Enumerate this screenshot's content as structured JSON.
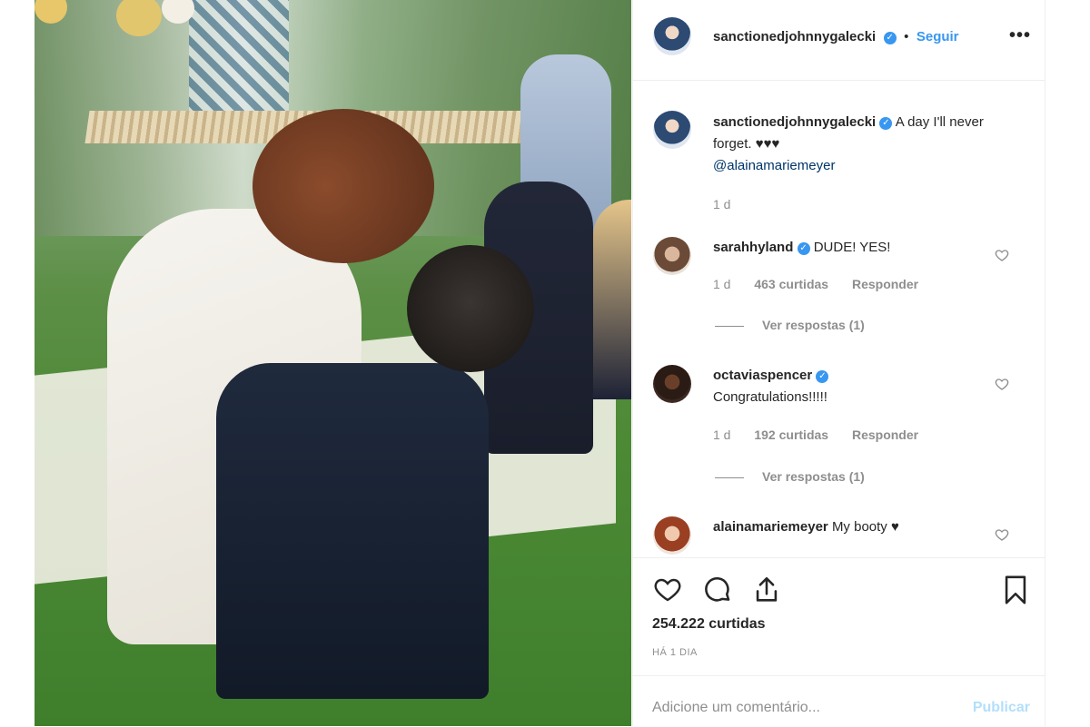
{
  "header": {
    "username": "sanctionedjohnnygalecki",
    "separator": "•",
    "follow_label": "Seguir",
    "more": "•••"
  },
  "caption": {
    "username": "sanctionedjohnnygalecki",
    "text": "A day I'll never forget. ♥♥♥",
    "mention": "@alainamariemeyer",
    "time": "1 d"
  },
  "comments": [
    {
      "username": "sarahhyland",
      "verified": true,
      "text": "DUDE! YES!",
      "time": "1 d",
      "likes": "463 curtidas",
      "reply": "Responder",
      "view_replies": "Ver respostas (1)"
    },
    {
      "username": "octaviaspencer",
      "verified": true,
      "text": "Congratulations!!!!!",
      "time": "1 d",
      "likes": "192 curtidas",
      "reply": "Responder",
      "view_replies": "Ver respostas (1)"
    },
    {
      "username": "alainamariemeyer",
      "verified": false,
      "text": "My booty ♥"
    }
  ],
  "likes": "254.222 curtidas",
  "timestamp": "HÁ 1 DIA",
  "comment_input": {
    "placeholder": "Adicione um comentário...",
    "publish_label": "Publicar"
  },
  "icons": {
    "like": "heart-icon",
    "comment": "comment-icon",
    "share": "share-icon",
    "save": "bookmark-icon"
  }
}
